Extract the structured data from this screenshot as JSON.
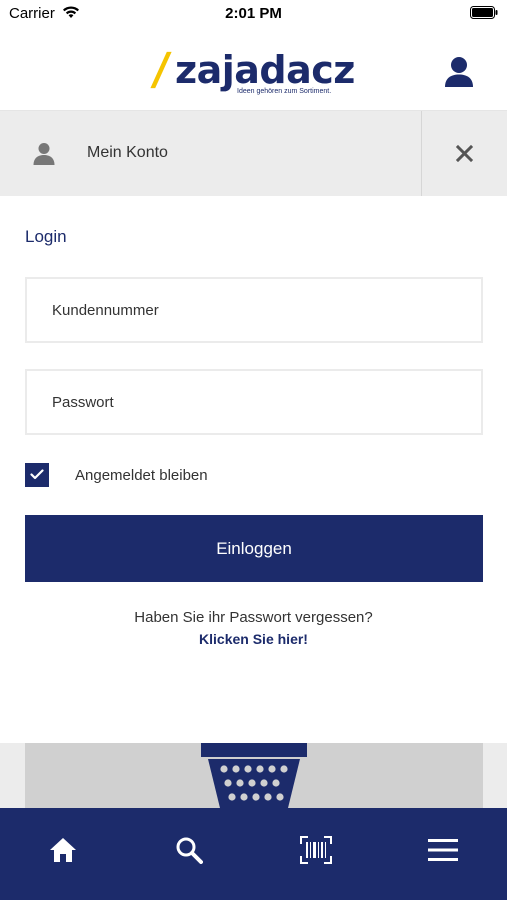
{
  "status_bar": {
    "carrier": "Carrier",
    "time": "2:01 PM"
  },
  "header": {
    "logo_slash": "/",
    "logo_word": "zajadacz",
    "logo_tagline": "Ideen gehören zum Sortiment."
  },
  "account_bar": {
    "label": "Mein Konto"
  },
  "login": {
    "title": "Login",
    "customer_number_placeholder": "Kundennummer",
    "password_placeholder": "Passwort",
    "stay_logged_in_label": "Angemeldet bleiben",
    "stay_logged_in_checked": true,
    "submit_label": "Einloggen",
    "forgot_text": "Haben Sie ihr Passwort vergessen?",
    "forgot_link": "Klicken Sie hier!"
  },
  "bottom_nav": {
    "items": [
      {
        "icon": "home-icon"
      },
      {
        "icon": "search-icon"
      },
      {
        "icon": "barcode-scan-icon"
      },
      {
        "icon": "hamburger-menu-icon"
      }
    ]
  },
  "colors": {
    "brand_navy": "#1c2b6b",
    "brand_yellow": "#f5c400",
    "panel_gray": "#ececec"
  }
}
